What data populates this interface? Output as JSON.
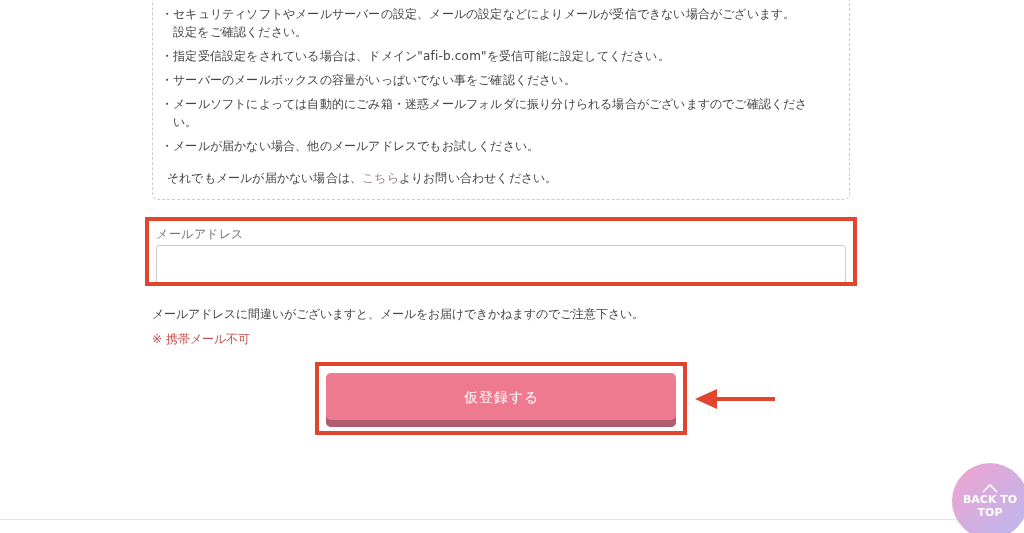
{
  "notice": {
    "items": [
      {
        "lines": [
          "・セキュリティソフトやメールサーバーの設定、メールの設定などによりメールが受信できない場合がございます。",
          "設定をご確認ください。"
        ]
      },
      {
        "lines": [
          "・指定受信設定をされている場合は、ドメイン\"afi-b.com\"を受信可能に設定してください。"
        ]
      },
      {
        "lines": [
          "・サーバーのメールボックスの容量がいっぱいでない事をご確認ください。"
        ]
      },
      {
        "lines": [
          "・メールソフトによっては自動的にごみ箱・迷惑メールフォルダに振り分けられる場合がございますのでご確認くださ",
          "い。"
        ]
      },
      {
        "lines": [
          "・メールが届かない場合、他のメールアドレスでもお試しください。"
        ]
      }
    ],
    "contact": {
      "before": "それでもメールが届かない場合は、",
      "link": "こちら",
      "after": "よりお問い合わせください。"
    }
  },
  "email_field": {
    "label": "メールアドレス",
    "highlighted": true
  },
  "note": "メールアドレスに間違いがございますと、メールをお届けできかねますのでご注意下さい。",
  "warning": "※ 携帯メール不可",
  "submit": {
    "label": "仮登録する",
    "highlighted": true
  },
  "back_to_top": {
    "lines": [
      "BACK TO",
      "TOP"
    ]
  }
}
